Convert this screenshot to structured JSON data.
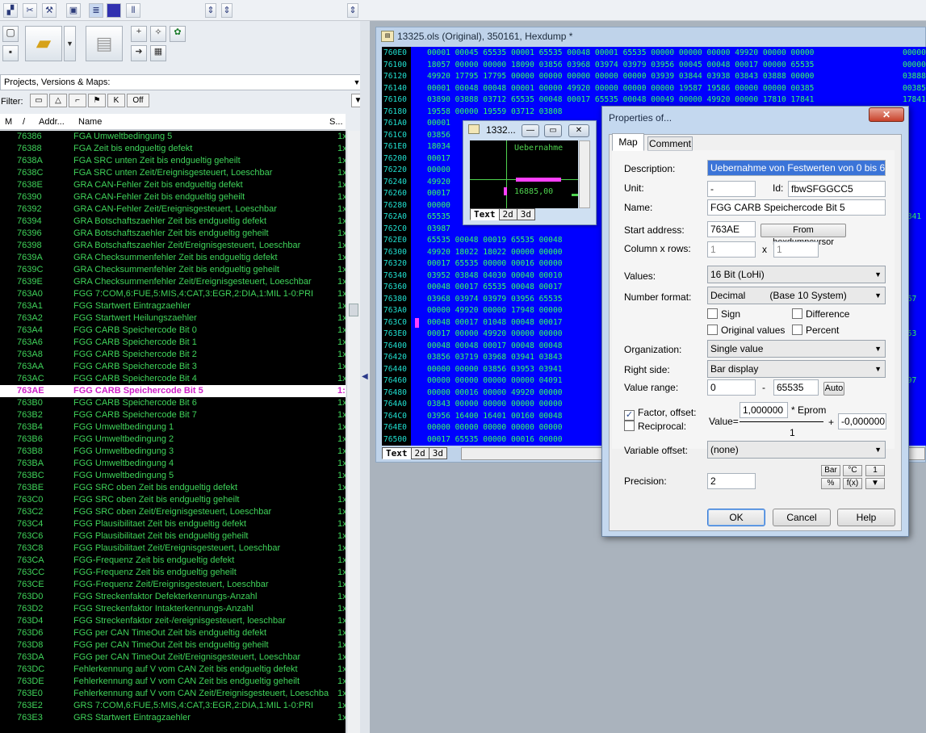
{
  "toolbar": {
    "icons": [
      "chart-icon",
      "tools-icon",
      "wrench-icon",
      "compare-icon",
      "list-view-icon",
      "square-icon",
      "barcode-icon"
    ]
  },
  "left": {
    "projects_select": "Projects, Versions & Maps:",
    "filter_label": "Filter:",
    "filter_off": "Off",
    "headers": {
      "m": "M",
      "slash": "/",
      "addr": "Addr...",
      "name": "Name",
      "s": "S..."
    },
    "rows": [
      {
        "addr": "76386",
        "name": "FGA Umweltbedingung 5",
        "s": "1x"
      },
      {
        "addr": "76388",
        "name": "FGA  Zeit bis endgueltig defekt",
        "s": "1x"
      },
      {
        "addr": "7638A",
        "name": "FGA SRC unten  Zeit bis endgueltig geheilt",
        "s": "1x"
      },
      {
        "addr": "7638C",
        "name": "FGA SRC unten  Zeit/Ereignisgesteuert, Loeschbar",
        "s": "1x"
      },
      {
        "addr": "7638E",
        "name": "GRA CAN-Fehler Zeit bis endgueltig defekt",
        "s": "1x"
      },
      {
        "addr": "76390",
        "name": "GRA CAN-Fehler  Zeit bis endgueltig geheilt",
        "s": "1x"
      },
      {
        "addr": "76392",
        "name": "GRA CAN-Fehler  Zeit/Ereignisgesteuert, Loeschbar",
        "s": "1x"
      },
      {
        "addr": "76394",
        "name": "GRA Botschaftszaehler Zeit bis endgueltig defekt",
        "s": "1x"
      },
      {
        "addr": "76396",
        "name": "GRA Botschaftszaehler Zeit bis endgueltig geheilt",
        "s": "1x"
      },
      {
        "addr": "76398",
        "name": "GRA Botschaftszaehler Zeit/Ereignisgesteuert, Loeschbar",
        "s": "1x"
      },
      {
        "addr": "7639A",
        "name": "GRA Checksummenfehler Zeit bis endgueltig defekt",
        "s": "1x"
      },
      {
        "addr": "7639C",
        "name": "GRA Checksummenfehler Zeit bis endgueltig geheilt",
        "s": "1x"
      },
      {
        "addr": "7639E",
        "name": "GRA Checksummenfehler Zeit/Ereignisgesteuert, Loeschbar",
        "s": "1x"
      },
      {
        "addr": "763A0",
        "name": "FGG  7:COM,6:FUE,5:MIS,4:CAT,3:EGR,2:DIA,1:MIL 1-0:PRI",
        "s": "1x"
      },
      {
        "addr": "763A1",
        "name": "FGG  Startwert Eintragzaehler",
        "s": "1x"
      },
      {
        "addr": "763A2",
        "name": "FGG  Startwert Heilungszaehler",
        "s": "1x"
      },
      {
        "addr": "763A4",
        "name": "FGG  CARB Speichercode Bit 0",
        "s": "1x"
      },
      {
        "addr": "763A6",
        "name": "FGG  CARB Speichercode Bit 1",
        "s": "1x"
      },
      {
        "addr": "763A8",
        "name": "FGG  CARB Speichercode Bit 2",
        "s": "1x"
      },
      {
        "addr": "763AA",
        "name": "FGG  CARB Speichercode Bit 3",
        "s": "1x"
      },
      {
        "addr": "763AC",
        "name": "FGG  CARB Speichercode Bit 4",
        "s": "1x"
      },
      {
        "addr": "763AE",
        "name": "FGG  CARB Speichercode Bit 5",
        "s": "1:",
        "hl": true
      },
      {
        "addr": "763B0",
        "name": "FGG  CARB Speichercode Bit 6",
        "s": "1x"
      },
      {
        "addr": "763B2",
        "name": "FGG  CARB Speichercode Bit 7",
        "s": "1x"
      },
      {
        "addr": "763B4",
        "name": "FGG Umweltbedingung 1",
        "s": "1x"
      },
      {
        "addr": "763B6",
        "name": "FGG Umweltbedingung 2",
        "s": "1x"
      },
      {
        "addr": "763B8",
        "name": "FGG Umweltbedingung 3",
        "s": "1x"
      },
      {
        "addr": "763BA",
        "name": "FGG Umweltbedingung 4",
        "s": "1x"
      },
      {
        "addr": "763BC",
        "name": "FGG Umweltbedingung 5",
        "s": "1x"
      },
      {
        "addr": "763BE",
        "name": "FGG SRC oben  Zeit bis endgueltig defekt",
        "s": "1x"
      },
      {
        "addr": "763C0",
        "name": "FGG SRC oben  Zeit bis endgueltig geheilt",
        "s": "1x"
      },
      {
        "addr": "763C2",
        "name": "FGG SRC oben  Zeit/Ereignisgesteuert, Loeschbar",
        "s": "1x"
      },
      {
        "addr": "763C4",
        "name": "FGG Plausibilitaet  Zeit bis endgueltig defekt",
        "s": "1x"
      },
      {
        "addr": "763C6",
        "name": "FGG Plausibilitaet  Zeit bis endgueltig geheilt",
        "s": "1x"
      },
      {
        "addr": "763C8",
        "name": "FGG Plausibilitaet  Zeit/Ereignisgesteuert, Loeschbar",
        "s": "1x"
      },
      {
        "addr": "763CA",
        "name": "FGG-Frequenz  Zeit bis endgueltig defekt",
        "s": "1x"
      },
      {
        "addr": "763CC",
        "name": "FGG-Frequenz  Zeit bis endgueltig geheilt",
        "s": "1x"
      },
      {
        "addr": "763CE",
        "name": "FGG-Frequenz  Zeit/Ereignisgesteuert, Loeschbar",
        "s": "1x"
      },
      {
        "addr": "763D0",
        "name": "FGG  Streckenfaktor Defekterkennungs-Anzahl",
        "s": "1x"
      },
      {
        "addr": "763D2",
        "name": "FGG  Streckenfaktor Intakterkennungs-Anzahl",
        "s": "1x"
      },
      {
        "addr": "763D4",
        "name": "FGG  Streckenfaktor zeit-/ereignisgesteuert, loeschbar",
        "s": "1x"
      },
      {
        "addr": "763D6",
        "name": "FGG per CAN TimeOut Zeit bis endgueltig defekt",
        "s": "1x"
      },
      {
        "addr": "763D8",
        "name": "FGG per CAN TimeOut Zeit bis endgueltig geheilt",
        "s": "1x"
      },
      {
        "addr": "763DA",
        "name": "FGG per CAN TimeOut Zeit/Ereignisgesteuert, Loeschbar",
        "s": "1x"
      },
      {
        "addr": "763DC",
        "name": "Fehlerkennung auf V vom CAN  Zeit bis endgueltig defekt",
        "s": "1x"
      },
      {
        "addr": "763DE",
        "name": "Fehlerkennung auf V vom CAN  Zeit bis endgueltig geheilt",
        "s": "1x"
      },
      {
        "addr": "763E0",
        "name": "Fehlerkennung auf V vom CAN  Zeit/Ereignisgesteuert, Loeschba",
        "s": "1x"
      },
      {
        "addr": "763E2",
        "name": "GRS  7:COM,6:FUE,5:MIS,4:CAT,3:EGR,2:DIA,1:MIL 1-0:PRI",
        "s": "1x"
      },
      {
        "addr": "763E3",
        "name": "GRS  Startwert Eintragzaehler",
        "s": "1x"
      }
    ]
  },
  "hexwin": {
    "title": "13325.ols (Original), 350161, Hexdump *",
    "tabs": [
      "Text",
      "2d",
      "3d"
    ],
    "rows": [
      {
        "addr": "760E0",
        "data": "00001 00045 65535 00001 65535 00048 00001 65535 00000 00000 00000 49920 00000 00000"
      },
      {
        "addr": "76100",
        "data": "18057 00000 00000 18090 03856 03968 03974 03979 03956 00045 00048 00017 00000 65535"
      },
      {
        "addr": "76120",
        "data": "49920 17795 17795 00000 00000 00000 00000 00000 03939 03844 03938 03843 03888 00000"
      },
      {
        "addr": "76140",
        "data": "00001 00048 00048 00001 00000 49920 00000 00000 00000 19587 19586 00000 00000 00385"
      },
      {
        "addr": "76160",
        "data": "03890 03888 03712 65535 00048 00017 65535 00048 00049 00000 49920 00000 17810 17841"
      },
      {
        "addr": "76180",
        "data": "19558 00000 19559 03712 03808"
      },
      {
        "addr": "761A0",
        "data": "00001"
      },
      {
        "addr": "761C0",
        "data": "03856"
      },
      {
        "addr": "761E0",
        "data": "18034"
      },
      {
        "addr": "76200",
        "data": "00017"
      },
      {
        "addr": "76220",
        "data": "00000"
      },
      {
        "addr": "76240",
        "data": "49920"
      },
      {
        "addr": "76260",
        "data": "00017"
      },
      {
        "addr": "76280",
        "data": "00000"
      },
      {
        "addr": "762A0",
        "data": "65535"
      },
      {
        "addr": "762C0",
        "data": "03987"
      },
      {
        "addr": "762E0",
        "data": "65535 00048 00019 65535 00048"
      },
      {
        "addr": "76300",
        "data": "49920 18022 18022 00000 00000"
      },
      {
        "addr": "76320",
        "data": "00017 65535 00000 00016 00000"
      },
      {
        "addr": "76340",
        "data": "03952 03848 04030 00040 00010"
      },
      {
        "addr": "76360",
        "data": "00048 00017 65535 00048 00017"
      },
      {
        "addr": "76380",
        "data": "03968 03974 03979 03956 65535"
      },
      {
        "addr": "763A0",
        "data": "00000 49920 00000 17948 00000"
      },
      {
        "addr": "763C0",
        "data": "00048 00017 01048 00048 00017"
      },
      {
        "addr": "763E0",
        "data": "00017 00000 49920 00000 00000"
      },
      {
        "addr": "76400",
        "data": "00048 00048 00017 00048 00048"
      },
      {
        "addr": "76420",
        "data": "03856 03719 03968 03941 03843"
      },
      {
        "addr": "76440",
        "data": "00000 00000 03856 03953 03941"
      },
      {
        "addr": "76460",
        "data": "00000 00000 00000 00000 04091"
      },
      {
        "addr": "76480",
        "data": "00000 00016 00000 49920 00000"
      },
      {
        "addr": "764A0",
        "data": "03843 00000 00000 00000 00000"
      },
      {
        "addr": "764C0",
        "data": "03956 16400 16401 00160 00048"
      },
      {
        "addr": "764E0",
        "data": "00000 00000 00000 00000 00000"
      },
      {
        "addr": "76500",
        "data": "00017 65535 00000 00016 00000"
      },
      {
        "addr": "76520",
        "data": "03952 03848 03968 65535 00048"
      }
    ],
    "right_cols": [
      "00000",
      "00000",
      "03888",
      "00385",
      "17841",
      "",
      "",
      "",
      "",
      "",
      "",
      "",
      "",
      "",
      "3841",
      "",
      "",
      "",
      "",
      "",
      "",
      "067",
      "",
      "",
      "553",
      "",
      "",
      "",
      "797",
      "",
      "",
      "",
      "",
      "",
      "791"
    ]
  },
  "miniwin": {
    "title": "1332...",
    "caption": "Uebernahme",
    "value": "16885,00",
    "tabs": [
      "Text",
      "2d",
      "3d"
    ]
  },
  "dialog": {
    "title": "Properties of...",
    "tabs": [
      "Map",
      "Comment"
    ],
    "description_label": "Description:",
    "description_value": "Uebernahme von Festwerten von 0 bis 65535",
    "unit_label": "Unit:",
    "unit_value": "-",
    "id_label": "Id:",
    "id_value": "fbwSFGGCC5",
    "name_label": "Name:",
    "name_value": "FGG  CARB Speichercode Bit 5",
    "start_label": "Start address:",
    "start_value": "763AE",
    "from_hex_button": "From hexdumpcursor",
    "colrows_label": "Column x rows:",
    "cols_value": "1",
    "x_label": "x",
    "rows_value": "1",
    "values_label": "Values:",
    "values_value": "16 Bit (LoHi)",
    "numfmt_label": "Number format:",
    "numfmt_value": "Decimal         (Base 10 System)",
    "sign_label": "Sign",
    "difference_label": "Difference",
    "original_label": "Original values",
    "percent_label": "Percent",
    "org_label": "Organization:",
    "org_value": "Single value",
    "right_label": "Right side:",
    "right_value": "Bar display",
    "range_label": "Value range:",
    "range_min": "0",
    "range_dash": "-",
    "range_max": "65535",
    "auto_button": "Auto",
    "factor_label": "Factor, offset:",
    "reciprocal_label": "Reciprocal:",
    "value_eq": "Value=",
    "factor_value": "1,000000",
    "eprom_label": "* Eprom",
    "plus_label": "+",
    "offset_value": "-0,000000",
    "denominator": "1",
    "varoffset_label": "Variable offset:",
    "varoffset_value": "(none)",
    "precision_label": "Precision:",
    "precision_value": "2",
    "small_buttons": [
      "Bar",
      "°C",
      "1",
      "%",
      "f(x)",
      "▼"
    ],
    "ok": "OK",
    "cancel": "Cancel",
    "help": "Help"
  }
}
